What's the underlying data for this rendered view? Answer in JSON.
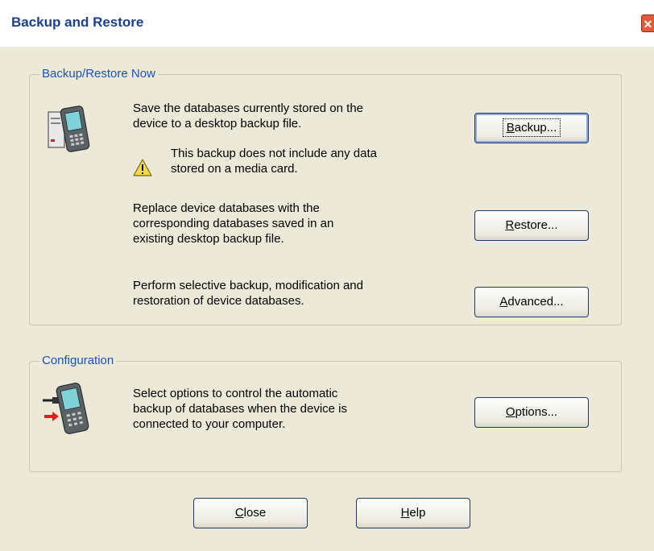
{
  "window": {
    "title": "Backup and Restore",
    "close_glyph": "✕"
  },
  "groups": {
    "backup_restore": {
      "title": "Backup/Restore Now",
      "backup_desc": [
        "Save the databases currently stored on the",
        "device to a desktop backup file."
      ],
      "warning": [
        "This backup does not include any data",
        "stored on a media card."
      ],
      "restore_desc": [
        "Replace device databases with the",
        "corresponding databases saved in an",
        "existing desktop backup file."
      ],
      "advanced_desc": [
        "Perform selective backup, modification and",
        "restoration of device databases."
      ],
      "backup_button": {
        "mnemonic": "B",
        "rest": "ackup..."
      },
      "restore_button": {
        "mnemonic": "R",
        "rest": "estore..."
      },
      "advanced_button": {
        "mnemonic": "A",
        "rest": "dvanced..."
      }
    },
    "configuration": {
      "title": "Configuration",
      "options_desc": [
        "Select options to control the automatic",
        "backup of databases when the device is",
        "connected to your computer."
      ],
      "options_button": {
        "mnemonic": "O",
        "rest": "ptions..."
      }
    }
  },
  "footer": {
    "close_button": {
      "mnemonic": "C",
      "rest": "lose"
    },
    "help_button": {
      "mnemonic": "H",
      "rest": "elp"
    }
  },
  "icons": {
    "device_backup": "device-with-desktop-icon",
    "warning": "warning-icon",
    "device_connect": "device-connect-icon"
  },
  "colors": {
    "title_text": "#1a3f93",
    "group_title": "#1b53b8",
    "dialog_bg": "#ece9d8",
    "close_button": "#e15b3b"
  }
}
